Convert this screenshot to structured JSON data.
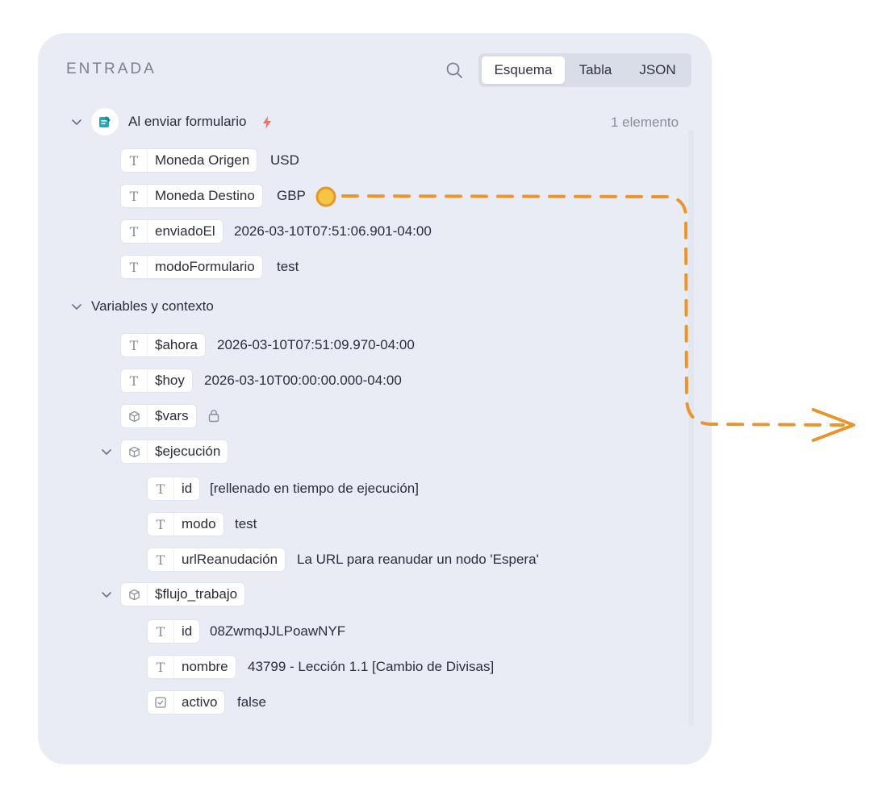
{
  "panel": {
    "title": "ENTRADA",
    "tabs": [
      {
        "label": "Esquema",
        "active": true
      },
      {
        "label": "Tabla",
        "active": false
      },
      {
        "label": "JSON",
        "active": false
      }
    ]
  },
  "trigger": {
    "label": "Al enviar formulario",
    "count": "1 elemento",
    "fields": [
      {
        "name": "Moneda Origen",
        "value": "USD",
        "type": "text"
      },
      {
        "name": "Moneda Destino",
        "value": "GBP",
        "type": "text"
      },
      {
        "name": "enviadoEl",
        "value": "2026-03-10T07:51:06.901-04:00",
        "type": "text"
      },
      {
        "name": "modoFormulario",
        "value": "test",
        "type": "text"
      }
    ]
  },
  "context": {
    "label": "Variables y contexto",
    "items": [
      {
        "name": "$ahora",
        "value": "2026-03-10T07:51:09.970-04:00",
        "type": "text"
      },
      {
        "name": "$hoy",
        "value": "2026-03-10T00:00:00.000-04:00",
        "type": "text"
      },
      {
        "name": "$vars",
        "value": "",
        "type": "object",
        "locked": true
      }
    ],
    "execution": {
      "name": "$ejecución",
      "fields": [
        {
          "name": "id",
          "value": "[rellenado en tiempo de ejecución]",
          "type": "text"
        },
        {
          "name": "modo",
          "value": "test",
          "type": "text"
        },
        {
          "name": "urlReanudación",
          "value": "La URL para reanudar un nodo 'Espera'",
          "type": "text"
        }
      ]
    },
    "workflow": {
      "name": "$flujo_trabajo",
      "fields": [
        {
          "name": "id",
          "value": "08ZwmqJJLPoawNYF",
          "type": "text"
        },
        {
          "name": "nombre",
          "value": "43799 - Lección 1.1 [Cambio de Divisas]",
          "type": "text"
        },
        {
          "name": "activo",
          "value": "false",
          "type": "boolean"
        }
      ]
    }
  },
  "icons": {
    "search": "search-icon",
    "chevron": "chevron-down-icon",
    "text_type": "text-type-icon",
    "object_type": "cube-icon",
    "boolean_type": "checkbox-icon",
    "lock": "lock-icon",
    "form_trigger": "form-icon",
    "lightning": "lightning-icon"
  },
  "colors": {
    "accent_orange": "#e8962b",
    "lightning": "#e5746e",
    "form_icon": "#29a7b9"
  }
}
